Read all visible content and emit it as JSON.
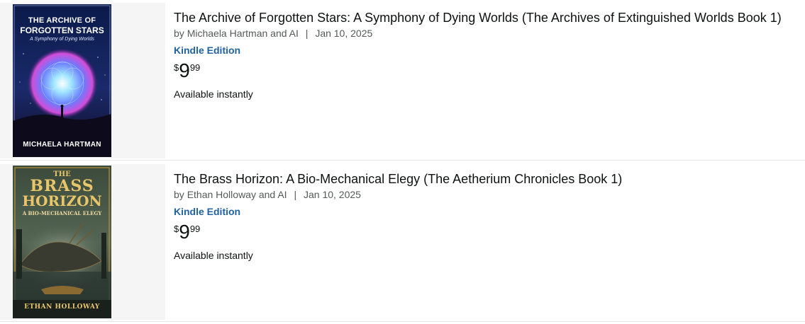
{
  "results": [
    {
      "title": "The Archive of Forgotten Stars: A Symphony of Dying Worlds (The Archives of Extinguished Worlds Book 1)",
      "byline_prefix": "by",
      "authors": "Michaela Hartman and AI",
      "date": "Jan 10, 2025",
      "format": "Kindle Edition",
      "price_symbol": "$",
      "price_whole": "9",
      "price_fraction": "99",
      "availability": "Available instantly",
      "cover": {
        "line1": "THE ARCHIVE OF",
        "line2": "FORGOTTEN STARS",
        "subtitle": "A Symphony of Dying Worlds",
        "author": "MICHAELA HARTMAN",
        "bg_top": "#0a1540",
        "bg_bottom": "#1a1030",
        "accent": "#7fd8ff"
      }
    },
    {
      "title": "The Brass Horizon: A Bio-Mechanical Elegy (The Aetherium Chronicles Book 1)",
      "byline_prefix": "by",
      "authors": "Ethan Holloway and AI",
      "date": "Jan 10, 2025",
      "format": "Kindle Edition",
      "price_symbol": "$",
      "price_whole": "9",
      "price_fraction": "99",
      "availability": "Available instantly",
      "cover": {
        "line1": "THE",
        "line2": "BRASS",
        "line3": "HORIZON",
        "subtitle": "A BIO-MECHANICAL ELEGY",
        "author": "ETHAN HOLLOWAY",
        "bg_top": "#2e3a2c",
        "bg_bottom": "#1e2620",
        "accent": "#d4a640"
      }
    }
  ]
}
